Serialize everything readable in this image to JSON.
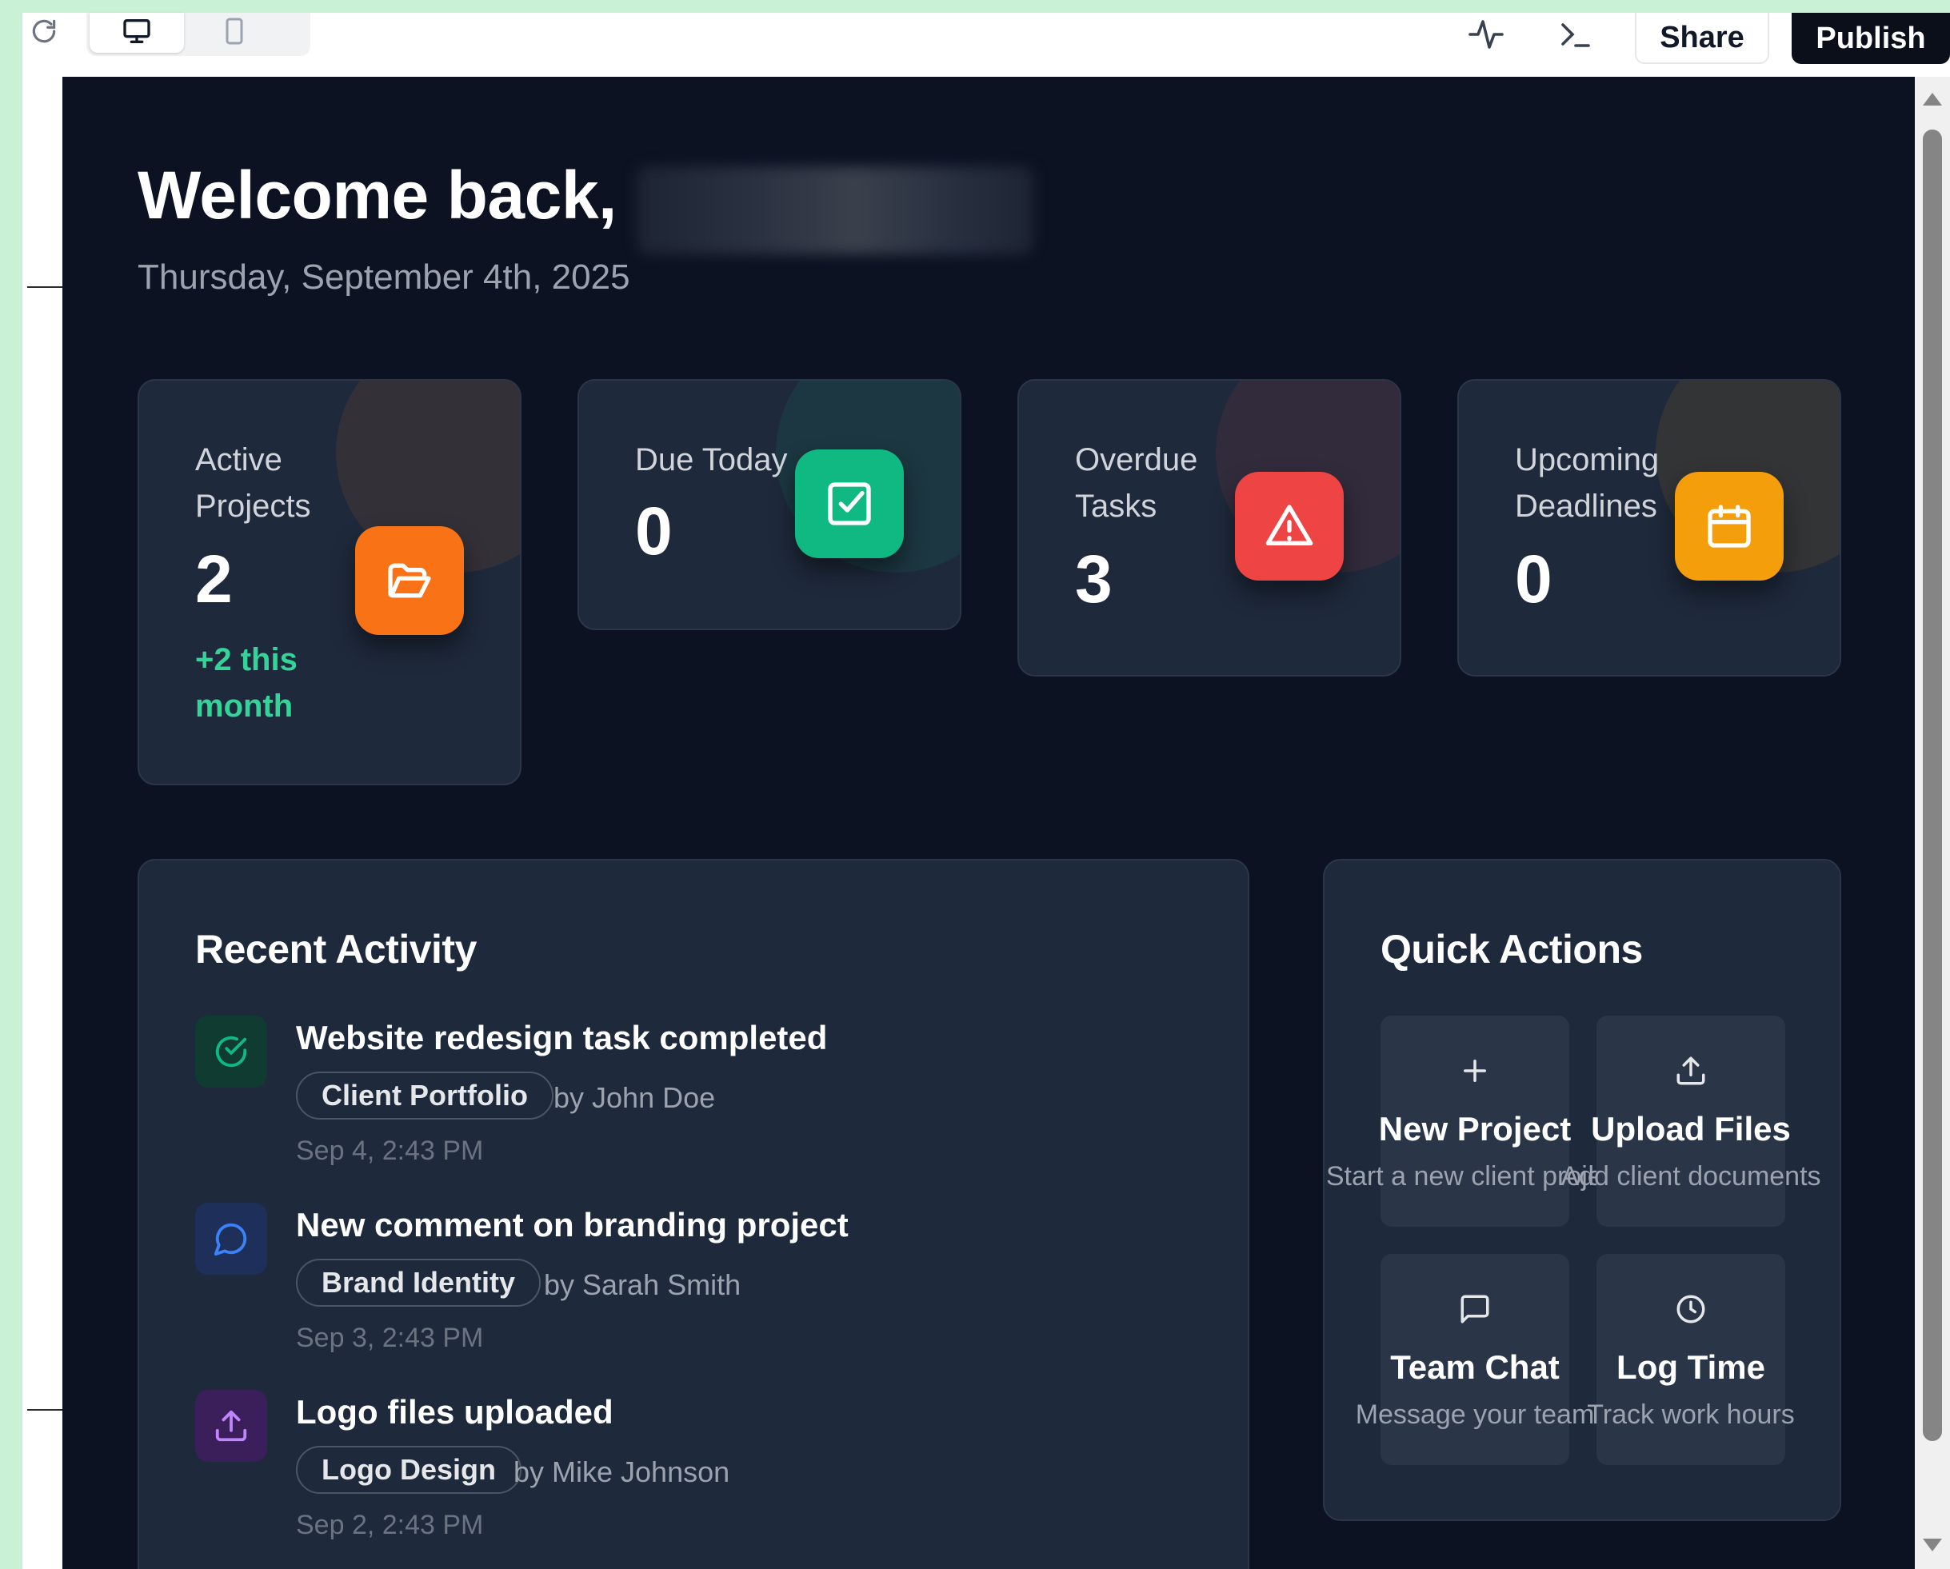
{
  "toolbar": {
    "share_label": "Share",
    "publish_label": "Publish",
    "icons": [
      "refresh-icon",
      "desktop-icon",
      "mobile-icon",
      "activity-icon",
      "terminal-icon"
    ]
  },
  "header": {
    "welcome_text": "Welcome back,",
    "date_text": "Thursday, September 4th, 2025"
  },
  "stats": [
    {
      "label": "Active Projects",
      "value": "2",
      "sub": "+2 this month",
      "icon": "folder-open-icon",
      "color": "#f97316"
    },
    {
      "label": "Due Today",
      "value": "0",
      "icon": "check-square-icon",
      "color": "#10b981"
    },
    {
      "label": "Overdue Tasks",
      "value": "3",
      "icon": "alert-triangle-icon",
      "color": "#ef4444"
    },
    {
      "label": "Upcoming Deadlines",
      "value": "0",
      "icon": "calendar-icon",
      "color": "#f59e0b"
    }
  ],
  "recent_activity": {
    "title": "Recent Activity",
    "items": [
      {
        "title": "Website redesign task completed",
        "tag": "Client Portfolio",
        "by": "by John Doe",
        "time": "Sep 4, 2:43 PM",
        "icon": "check-circle-icon",
        "color": "#10b981"
      },
      {
        "title": "New comment on branding project",
        "tag": "Brand Identity",
        "by": "by Sarah Smith",
        "time": "Sep 3, 2:43 PM",
        "icon": "message-circle-icon",
        "color": "#3b82f6"
      },
      {
        "title": "Logo files uploaded",
        "tag": "Logo Design",
        "by": "by Mike Johnson",
        "time": "Sep 2, 2:43 PM",
        "icon": "upload-icon",
        "color": "#a855f7"
      }
    ]
  },
  "quick_actions": {
    "title": "Quick Actions",
    "items": [
      {
        "label": "New Project",
        "desc": "Start a new client project",
        "icon": "plus-icon"
      },
      {
        "label": "Upload Files",
        "desc": "Add client documents",
        "icon": "upload-icon"
      },
      {
        "label": "Team Chat",
        "desc": "Message your team",
        "icon": "message-square-icon"
      },
      {
        "label": "Log Time",
        "desc": "Track work hours",
        "icon": "clock-icon"
      }
    ]
  }
}
